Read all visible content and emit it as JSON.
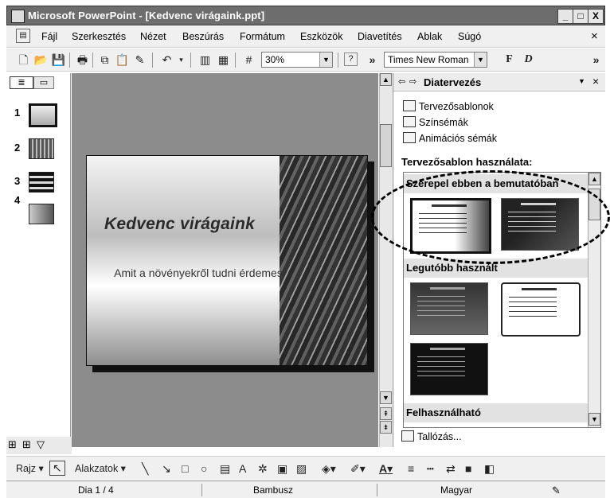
{
  "window": {
    "title": "Microsoft PowerPoint - [Kedvenc virágaink.ppt]",
    "min_label": "_",
    "max_label": "□",
    "close_label": "X",
    "doc_close_label": "×"
  },
  "menu": [
    {
      "label": "Fájl",
      "id": "file"
    },
    {
      "label": "Szerkesztés",
      "id": "edit"
    },
    {
      "label": "Nézet",
      "id": "view"
    },
    {
      "label": "Beszúrás",
      "id": "insert"
    },
    {
      "label": "Formátum",
      "id": "format"
    },
    {
      "label": "Eszközök",
      "id": "tools"
    },
    {
      "label": "Diavetítés",
      "id": "slideshow"
    },
    {
      "label": "Ablak",
      "id": "window"
    },
    {
      "label": "Súgó",
      "id": "help"
    }
  ],
  "toolbar": {
    "zoom": "30%",
    "font": "Times New Roman",
    "bold_label": "F",
    "italic_label": "D",
    "more_label": "»"
  },
  "outline": {
    "slides": [
      "1",
      "2",
      "3",
      "4"
    ]
  },
  "slide": {
    "title": "Kedvenc virágaink",
    "subtitle": "Amit a növényekről tudni érdemes"
  },
  "taskpane": {
    "title": "Diatervezés",
    "links": [
      "Tervezősablonok",
      "Színsémák",
      "Animációs sémák"
    ],
    "section_label": "Tervezősablon használata:",
    "group_current": "Szerepel ebben a bemutatóban",
    "group_recent": "Legutóbb használt",
    "group_available": "Felhasználható",
    "browse": "Tallózás...",
    "thumb_text": "Lorem ipsum"
  },
  "drawbar": {
    "draw": "Rajz",
    "shapes": "Alakzatok"
  },
  "status": {
    "slide": "Dia 1 / 4",
    "design": "Bambusz",
    "language": "Magyar"
  }
}
